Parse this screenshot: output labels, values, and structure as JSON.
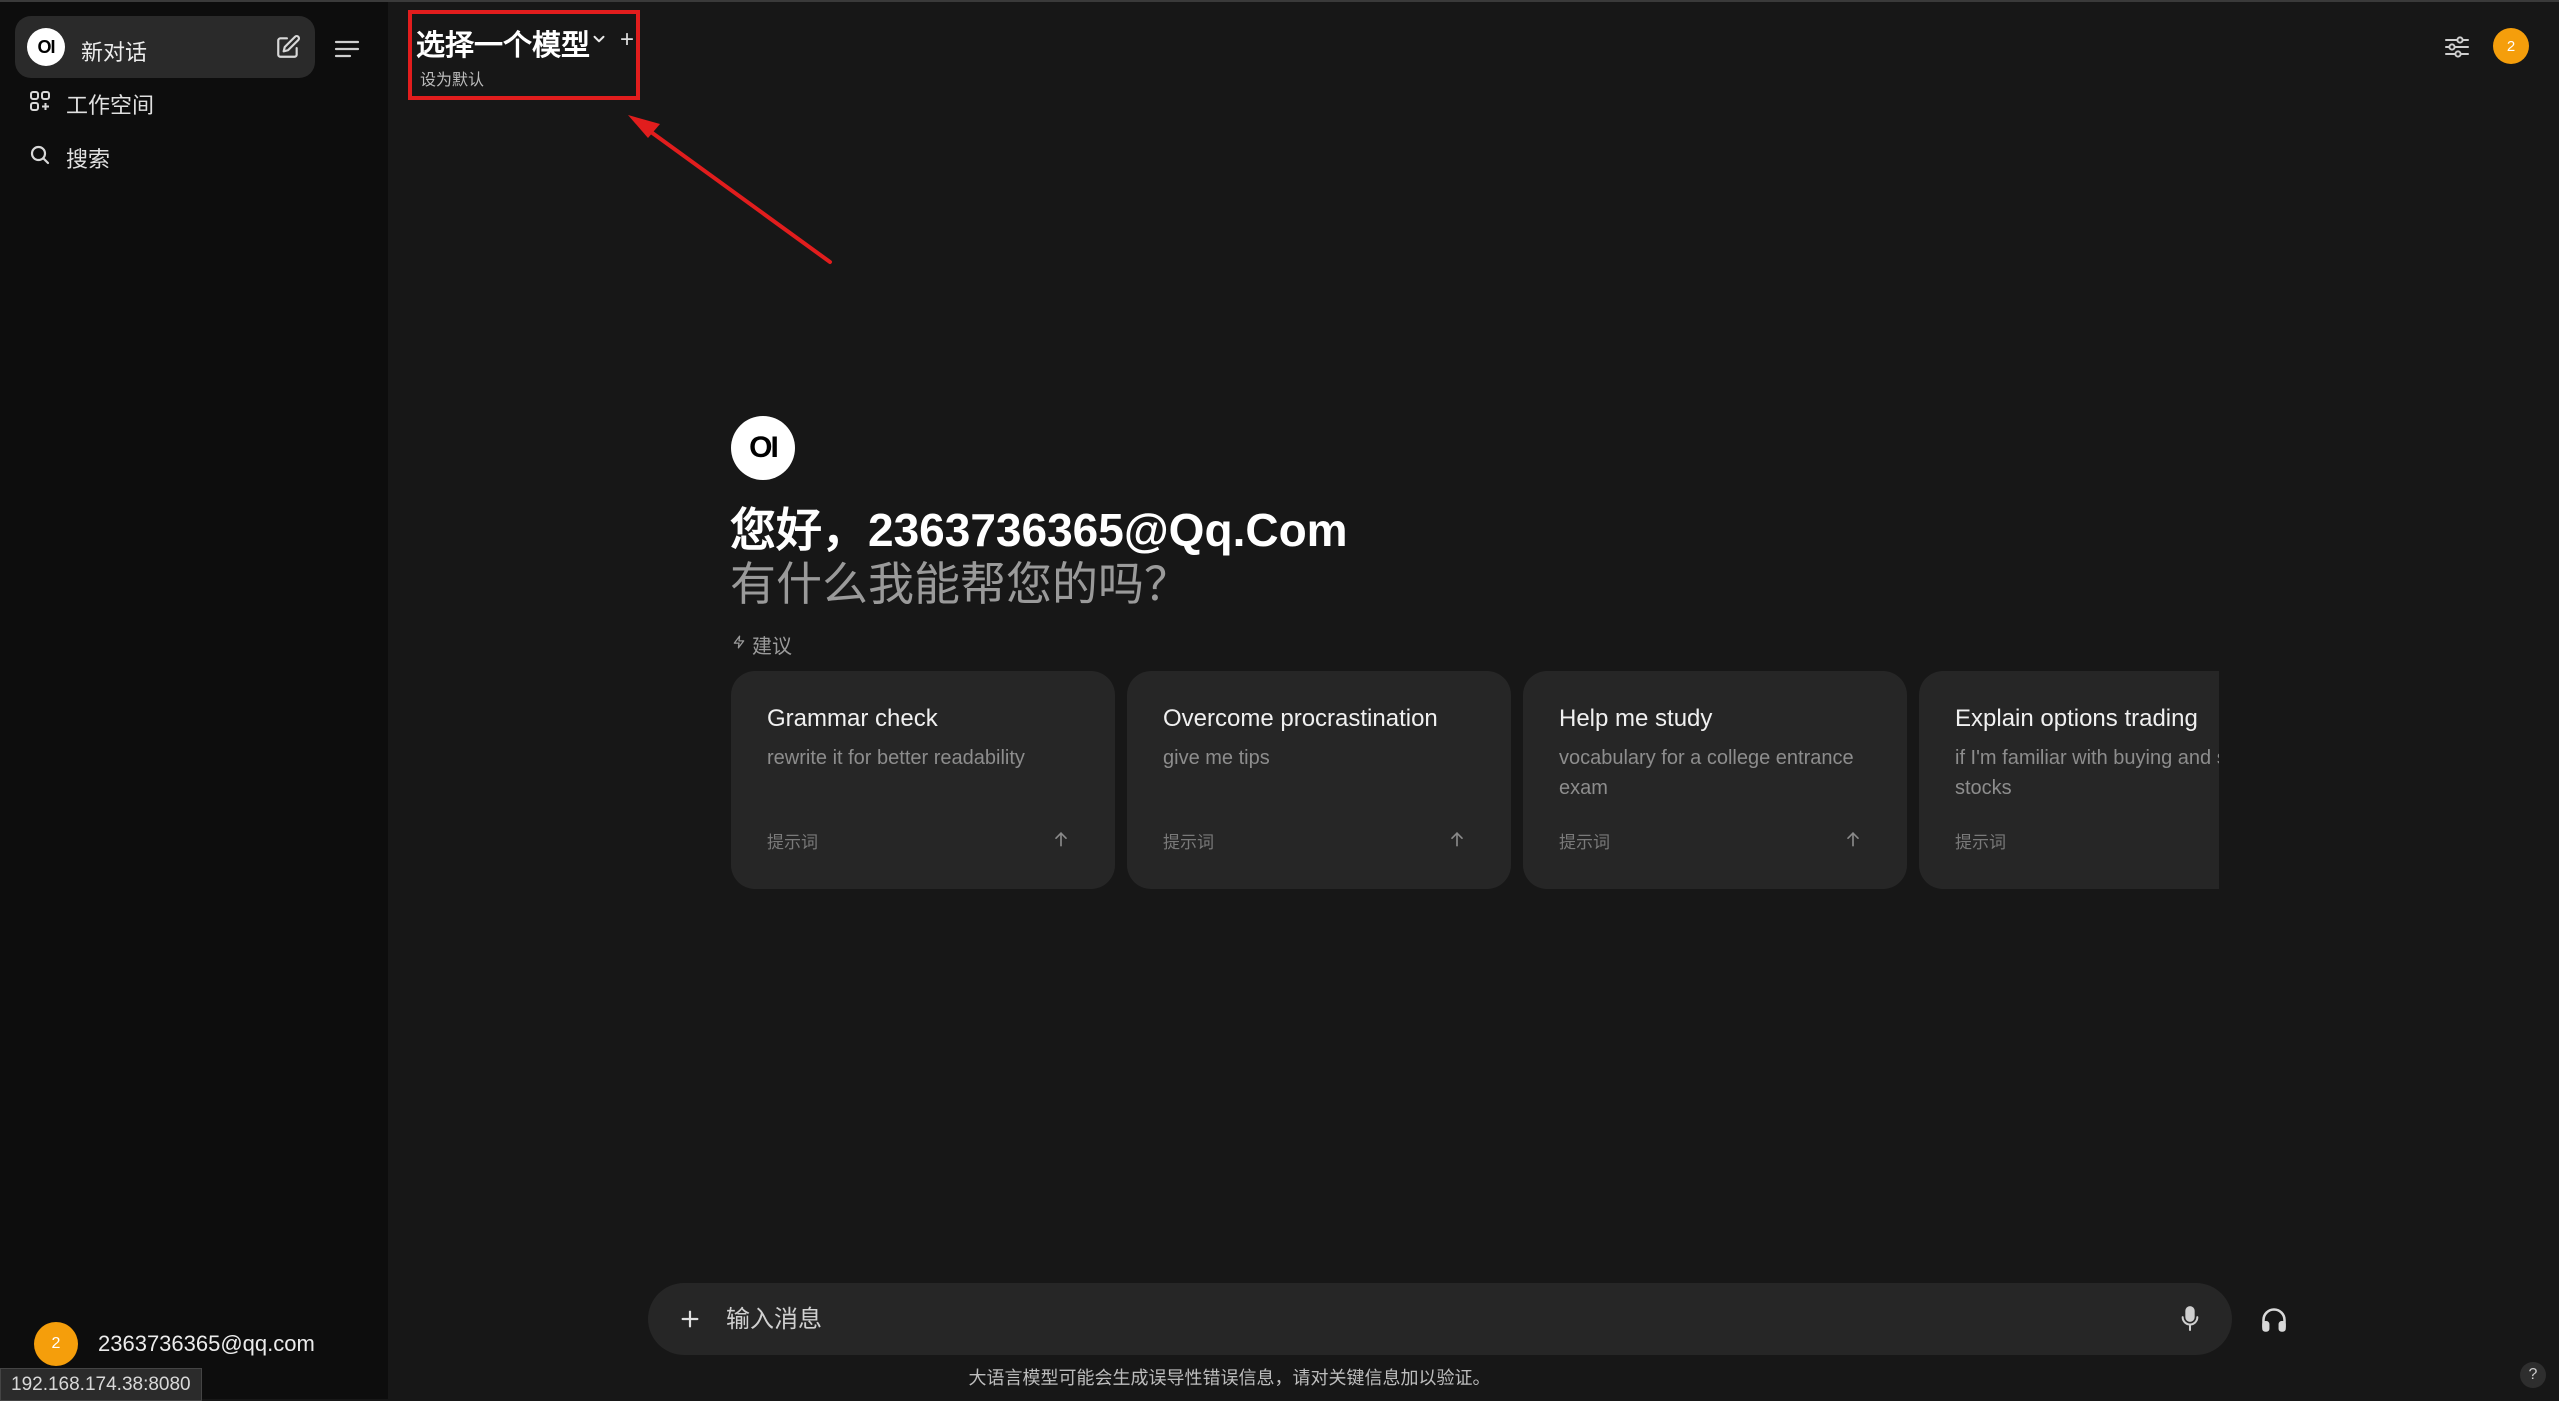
{
  "sidebar": {
    "new_chat_label": "新对话",
    "logo_text": "OI",
    "items": [
      {
        "label": "工作空间",
        "icon": "grid-plus-icon"
      },
      {
        "label": "搜索",
        "icon": "search-icon"
      }
    ],
    "user_avatar": "2",
    "user_email": "2363736365@qq.com"
  },
  "status_bar": {
    "url": "192.168.174.38:8080"
  },
  "header": {
    "model_title": "选择一个模型",
    "set_default": "设为默认",
    "plus": "+",
    "avatar_text": "2"
  },
  "welcome": {
    "logo_text": "OI",
    "greeting": "您好，2363736365@Qq.Com",
    "subtitle": "有什么我能帮您的吗？",
    "suggestions_label": "建议"
  },
  "suggestions": [
    {
      "title": "Grammar check",
      "subtitle": "rewrite it for better readability",
      "tag": "提示词"
    },
    {
      "title": "Overcome procrastination",
      "subtitle": "give me tips",
      "tag": "提示词"
    },
    {
      "title": "Help me study",
      "subtitle": "vocabulary for a college entrance exam",
      "tag": "提示词"
    },
    {
      "title": "Explain options trading",
      "subtitle": "if I'm familiar with buying and selling stocks",
      "tag": "提示词"
    }
  ],
  "input": {
    "placeholder": "输入消息"
  },
  "footer": {
    "disclaimer": "大语言模型可能会生成误导性错误信息，请对关键信息加以验证。",
    "help": "?"
  },
  "colors": {
    "background": "#171717",
    "sidebar": "#0d0d0d",
    "accent": "#f59e0b",
    "highlight": "#e11d1d"
  }
}
